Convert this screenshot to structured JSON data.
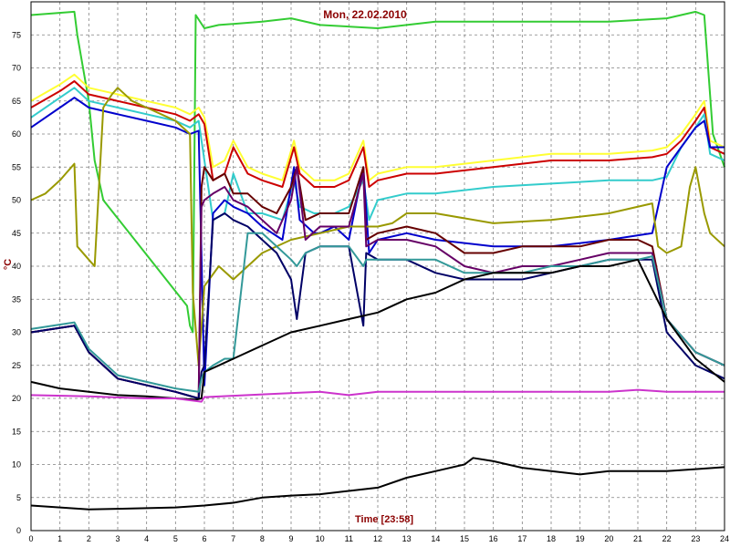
{
  "chart_data": {
    "type": "line",
    "title": "Mon, 22.02.2010",
    "xlabel": "Time [23:58]",
    "ylabel": "°C",
    "xlim": [
      0,
      24
    ],
    "ylim": [
      0,
      80
    ],
    "xticks": [
      0,
      1,
      2,
      3,
      4,
      5,
      6,
      7,
      8,
      9,
      10,
      11,
      12,
      13,
      14,
      15,
      16,
      17,
      18,
      19,
      20,
      21,
      22,
      23,
      24
    ],
    "yticks": [
      0,
      5,
      10,
      15,
      20,
      25,
      30,
      35,
      40,
      45,
      50,
      55,
      60,
      65,
      70,
      75
    ],
    "grid": true,
    "series": [
      {
        "color": "#33cc33",
        "x": [
          0,
          1.5,
          1.6,
          2,
          2.2,
          2.5,
          5.4,
          5.5,
          5.6,
          5.7,
          6,
          6.5,
          8,
          9,
          10,
          12,
          14,
          16,
          18,
          20,
          22,
          22.5,
          23,
          23.3,
          23.6,
          24
        ],
        "y": [
          78,
          78.5,
          75,
          65,
          56,
          50,
          34,
          31,
          30,
          78,
          76,
          76.5,
          77,
          77.5,
          76.5,
          76,
          77,
          77,
          77,
          77,
          77.5,
          78,
          78.5,
          78,
          60,
          55
        ]
      },
      {
        "color": "#ffff33",
        "x": [
          0,
          1,
          1.5,
          2,
          3,
          4,
          5,
          5.5,
          5.8,
          6,
          6.3,
          6.7,
          7,
          7.5,
          8,
          8.7,
          9.1,
          9.3,
          9.8,
          10,
          10.5,
          11,
          11.5,
          11.7,
          12,
          13,
          14,
          16,
          18,
          20,
          21.5,
          22,
          22.5,
          23,
          23.3,
          23.5,
          24
        ],
        "y": [
          65,
          67.5,
          69,
          67,
          66,
          65,
          64,
          63,
          64,
          62.5,
          55,
          56,
          59,
          55,
          54,
          53,
          59,
          55,
          53,
          53,
          53,
          54,
          59,
          53,
          54,
          55,
          55,
          56,
          57,
          57,
          57.5,
          58,
          60,
          63,
          65,
          59,
          58
        ]
      },
      {
        "color": "#cc0000",
        "x": [
          0,
          1,
          1.5,
          2,
          3,
          4,
          5,
          5.5,
          5.8,
          6,
          6.3,
          6.7,
          7,
          7.5,
          8,
          8.7,
          9.1,
          9.3,
          9.8,
          10,
          10.5,
          11,
          11.5,
          11.7,
          12,
          13,
          14,
          16,
          18,
          20,
          21.5,
          22,
          22.5,
          23,
          23.3,
          23.5,
          24
        ],
        "y": [
          64,
          66.5,
          68,
          66,
          65,
          64,
          63,
          62,
          63,
          61.5,
          53,
          54,
          58,
          54,
          53,
          52,
          58,
          54,
          52,
          52,
          52,
          53,
          58,
          52,
          53,
          54,
          54,
          55,
          56,
          56,
          56.5,
          57,
          59,
          62,
          64,
          58,
          57
        ]
      },
      {
        "color": "#33cccc",
        "x": [
          0,
          1,
          1.5,
          2,
          3,
          4,
          5,
          5.5,
          5.8,
          6,
          6.3,
          6.7,
          7,
          7.5,
          8,
          8.7,
          9.1,
          9.3,
          9.8,
          10,
          10.5,
          11,
          11.5,
          11.7,
          12,
          13,
          14,
          16,
          18,
          20,
          21.5,
          22,
          22.5,
          23,
          23.3,
          23.5,
          24
        ],
        "y": [
          62.5,
          65.5,
          67,
          65,
          64,
          63,
          62,
          61,
          62,
          56,
          47,
          48,
          54,
          48,
          48,
          47,
          53,
          49,
          48,
          48,
          48,
          49,
          53,
          47,
          50,
          51,
          51,
          52,
          52.5,
          53,
          53,
          53.5,
          58,
          61,
          63,
          57,
          56
        ]
      },
      {
        "color": "#0000cc",
        "x": [
          0,
          1,
          1.5,
          2,
          3,
          4,
          5,
          5.5,
          5.8,
          6,
          6.3,
          6.7,
          7,
          7.5,
          8,
          8.7,
          9.1,
          9.3,
          9.8,
          10,
          10.5,
          11,
          11.5,
          11.7,
          12,
          13,
          14,
          16,
          18,
          20,
          21.5,
          22,
          22.5,
          23,
          23.3,
          23.5,
          24
        ],
        "y": [
          61,
          64,
          65.5,
          64,
          63,
          62,
          61,
          60,
          60.5,
          22,
          48,
          50,
          49,
          48,
          46,
          44,
          55,
          47,
          45,
          45,
          46,
          44,
          55,
          42,
          44,
          45,
          44,
          43,
          43,
          44,
          45,
          55,
          58,
          61,
          62,
          58,
          58
        ]
      },
      {
        "color": "#999900",
        "x": [
          0,
          0.5,
          1,
          1.2,
          1.4,
          1.5,
          1.6,
          2,
          2.2,
          2.5,
          2.8,
          3,
          3.5,
          4,
          5,
          5.5,
          5.6,
          5.8,
          6,
          6.5,
          7,
          8,
          9,
          10,
          11,
          12,
          12.5,
          13,
          14,
          16,
          18,
          20,
          21.5,
          21.7,
          22,
          22.5,
          22.8,
          23,
          23.3,
          23.5,
          24
        ],
        "y": [
          50,
          51,
          53,
          54,
          55,
          55.5,
          43,
          41,
          40,
          64,
          66,
          67,
          65,
          64,
          62,
          60,
          36,
          25,
          37,
          40,
          38,
          42,
          44,
          45,
          46,
          46,
          46.5,
          48,
          48,
          46.5,
          47,
          48,
          49.5,
          43,
          42,
          43,
          52,
          55,
          48,
          45,
          43
        ]
      },
      {
        "color": "#660000",
        "x": [
          0,
          1.5,
          2,
          3,
          5,
          5.8,
          5.9,
          6,
          6.3,
          6.7,
          7,
          7.5,
          8,
          8.5,
          9,
          9.2,
          9.5,
          10,
          11,
          11.5,
          11.6,
          12,
          13,
          14,
          15,
          16,
          17,
          18,
          19,
          20,
          21,
          21.5,
          22,
          23,
          24
        ],
        "y": [
          30,
          31,
          27,
          23,
          21,
          20,
          52,
          55,
          53,
          54,
          51,
          51,
          49,
          48,
          52,
          55,
          47,
          48,
          48,
          55,
          44,
          45,
          46,
          45,
          42,
          42,
          43,
          43,
          43,
          44,
          44,
          43,
          32,
          27,
          25
        ]
      },
      {
        "color": "#660066",
        "x": [
          0,
          1.5,
          2,
          3,
          5,
          5.8,
          5.9,
          6,
          6.3,
          6.7,
          7,
          7.5,
          8,
          8.5,
          9,
          9.2,
          9.5,
          10,
          11,
          11.5,
          11.6,
          12,
          13,
          14,
          15,
          16,
          17,
          18,
          19,
          20,
          21,
          21.5,
          22,
          23,
          24
        ],
        "y": [
          30,
          31,
          27,
          23,
          21,
          20,
          49,
          50,
          51,
          52,
          50,
          49,
          47,
          45,
          50,
          55,
          44,
          46,
          46,
          54,
          43,
          44,
          44,
          43,
          40,
          39,
          40,
          40,
          41,
          42,
          42,
          42,
          32,
          27,
          25
        ]
      },
      {
        "color": "#000066",
        "x": [
          0,
          1.5,
          2,
          3,
          5,
          5.8,
          5.9,
          6,
          6.3,
          6.7,
          7,
          7.5,
          8,
          8.5,
          9,
          9.2,
          9.5,
          10,
          11,
          11.5,
          11.6,
          12,
          13,
          14,
          15,
          16,
          17,
          18,
          19,
          20,
          21,
          21.5,
          22,
          23,
          24
        ],
        "y": [
          30,
          31,
          27,
          23,
          21,
          20,
          24,
          25,
          47,
          48,
          47,
          46,
          44,
          42,
          38,
          32,
          42,
          43,
          43,
          31,
          42,
          41,
          41,
          39,
          38,
          38,
          38,
          39,
          40,
          41,
          41,
          41,
          30,
          25,
          23
        ]
      },
      {
        "color": "#339999",
        "x": [
          0,
          1.5,
          2,
          3,
          5,
          5.8,
          5.9,
          6,
          6.3,
          6.7,
          7,
          7.5,
          8,
          8.5,
          9,
          9.2,
          9.5,
          10,
          11,
          11.5,
          11.6,
          12,
          13,
          14,
          15,
          16,
          17,
          18,
          19,
          20,
          21,
          21.5,
          22,
          23,
          24
        ],
        "y": [
          30.5,
          31.5,
          27.5,
          23.5,
          21.5,
          21,
          23,
          24,
          25,
          26,
          26,
          45,
          45,
          43,
          41,
          40,
          42,
          43,
          43,
          40,
          41,
          41,
          41,
          41,
          39,
          39,
          39,
          40,
          40,
          41,
          41,
          41.5,
          32,
          27,
          25
        ]
      },
      {
        "color": "#000000",
        "x": [
          0,
          1,
          2,
          3,
          4,
          5,
          5.7,
          5.9,
          6,
          6.5,
          7,
          8,
          9,
          10,
          11,
          12,
          13,
          14,
          15,
          16,
          17,
          18,
          19,
          20,
          21,
          22,
          23,
          24
        ],
        "y": [
          22.5,
          21.5,
          21,
          20.5,
          20.3,
          20,
          19.8,
          20,
          24,
          25,
          26,
          28,
          30,
          31,
          32,
          33,
          35,
          36,
          38,
          39,
          39,
          39,
          40,
          40,
          41,
          32,
          26,
          22.5
        ]
      },
      {
        "color": "#cc33cc",
        "x": [
          0,
          2,
          4,
          5,
          5.9,
          6,
          7,
          8,
          10,
          11,
          12,
          14,
          16,
          18,
          20,
          21,
          22,
          23,
          24
        ],
        "y": [
          20.5,
          20.3,
          20,
          20,
          19.5,
          20.2,
          20.4,
          20.6,
          21,
          20.5,
          21,
          21,
          21,
          21,
          21,
          21.3,
          21,
          21,
          21
        ]
      },
      {
        "color": "#000000",
        "x": [
          0,
          1,
          2,
          3,
          4,
          5,
          6,
          7,
          8,
          9,
          10,
          11,
          12,
          13,
          14,
          15,
          15.3,
          16,
          17,
          18,
          19,
          20,
          21,
          22,
          23,
          24
        ],
        "y": [
          3.8,
          3.5,
          3.2,
          3.3,
          3.4,
          3.5,
          3.8,
          4.2,
          5,
          5.3,
          5.5,
          6,
          6.5,
          8,
          9,
          10,
          11,
          10.5,
          9.5,
          9,
          8.5,
          9,
          9,
          9,
          9.3,
          9.6
        ]
      }
    ]
  }
}
